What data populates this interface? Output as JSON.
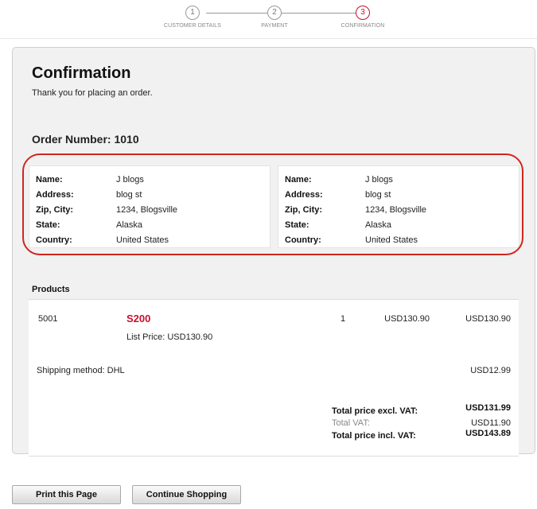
{
  "steps": [
    {
      "number": "1",
      "label": "CUSTOMER DETAILS"
    },
    {
      "number": "2",
      "label": "PAYMENT"
    },
    {
      "number": "3",
      "label": "CONFIRMATION"
    }
  ],
  "confirmation": {
    "title": "Confirmation",
    "subtitle": "Thank you for placing an order.",
    "order_number": "Order Number: 1010"
  },
  "address_labels": {
    "name": "Name:",
    "address": "Address:",
    "zip_city": "Zip, City:",
    "state": "State:",
    "country": "Country:"
  },
  "billing_address": {
    "name": "J blogs",
    "address": "blog st",
    "zip_city": "1234, Blogsville",
    "state": "Alaska",
    "country": "United States"
  },
  "shipping_address": {
    "name": "J blogs",
    "address": "blog st",
    "zip_city": "1234, Blogsville",
    "state": "Alaska",
    "country": "United States"
  },
  "products": {
    "heading": "Products",
    "item": {
      "sku": "5001",
      "name": "S200",
      "list_price": "List Price: USD130.90",
      "quantity": "1",
      "unit_price": "USD130.90",
      "total": "USD130.90"
    },
    "shipping": {
      "label": "Shipping method: DHL",
      "price": "USD12.99"
    },
    "totals": {
      "excl_label": "Total price excl. VAT:",
      "excl_value": "USD131.99",
      "vat_label": "Total VAT:",
      "vat_value": "USD11.90",
      "incl_label": "Total price incl. VAT:",
      "incl_value": "USD143.89"
    }
  },
  "actions": {
    "print": "Print this Page",
    "continue": "Continue Shopping"
  },
  "colors": {
    "accent": "#c8102e",
    "highlight_outline": "#d0261f"
  }
}
